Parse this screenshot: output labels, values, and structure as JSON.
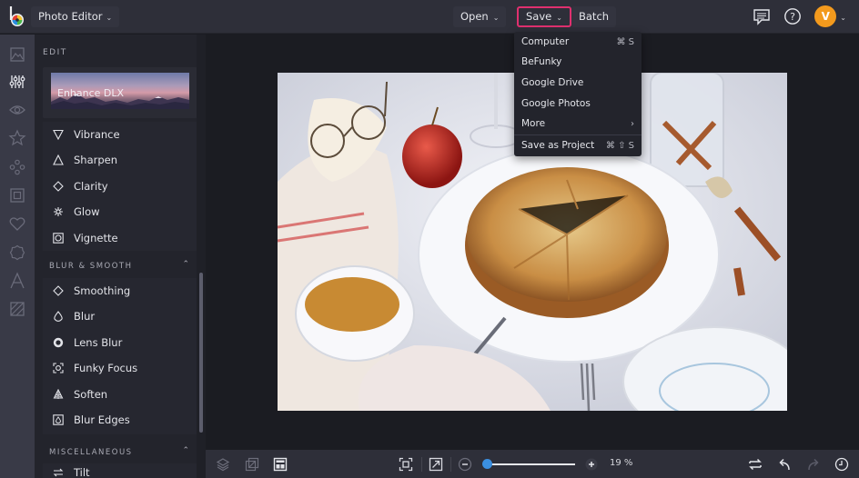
{
  "topbar": {
    "app_switch_label": "Photo Editor",
    "buttons": [
      {
        "label": "Open"
      },
      {
        "label": "Save"
      },
      {
        "label": "Batch"
      }
    ],
    "user_initial": "V"
  },
  "save_menu": {
    "items": [
      {
        "label": "Computer",
        "shortcut": "⌘ S"
      },
      {
        "label": "BeFunky",
        "shortcut": ""
      },
      {
        "label": "Google Drive",
        "shortcut": ""
      },
      {
        "label": "Google Photos",
        "shortcut": ""
      },
      {
        "label": "More",
        "shortcut": "›"
      },
      {
        "label": "Save as Project",
        "shortcut": "⌘ ⇧ S"
      }
    ]
  },
  "panel": {
    "title": "EDIT",
    "enhance_card_label": "Enhance DLX",
    "edit_tools": [
      {
        "label": "Vibrance",
        "icon": "triangle-down-icon"
      },
      {
        "label": "Sharpen",
        "icon": "triangle-up-icon"
      },
      {
        "label": "Clarity",
        "icon": "diamond-icon"
      },
      {
        "label": "Glow",
        "icon": "sparkle-icon"
      },
      {
        "label": "Vignette",
        "icon": "vignette-icon"
      }
    ],
    "blur_section_title": "BLUR & SMOOTH",
    "blur_tools": [
      {
        "label": "Smoothing",
        "icon": "diamond-icon"
      },
      {
        "label": "Blur",
        "icon": "drop-icon"
      },
      {
        "label": "Lens Blur",
        "icon": "aperture-icon"
      },
      {
        "label": "Funky Focus",
        "icon": "focus-icon"
      },
      {
        "label": "Soften",
        "icon": "tree-icon"
      },
      {
        "label": "Blur Edges",
        "icon": "blur-edges-icon"
      }
    ],
    "misc_section_title": "MISCELLANEOUS",
    "misc_tools": [
      {
        "label": "Tilt",
        "icon": "tilt-icon"
      }
    ]
  },
  "bottombar": {
    "zoom_percent": "19 %",
    "zoom_fraction": 0.0
  },
  "colors": {
    "accent_highlight": "#e0306f",
    "avatar_bg": "#f39a1d",
    "slider_knob": "#3b8fe0"
  }
}
